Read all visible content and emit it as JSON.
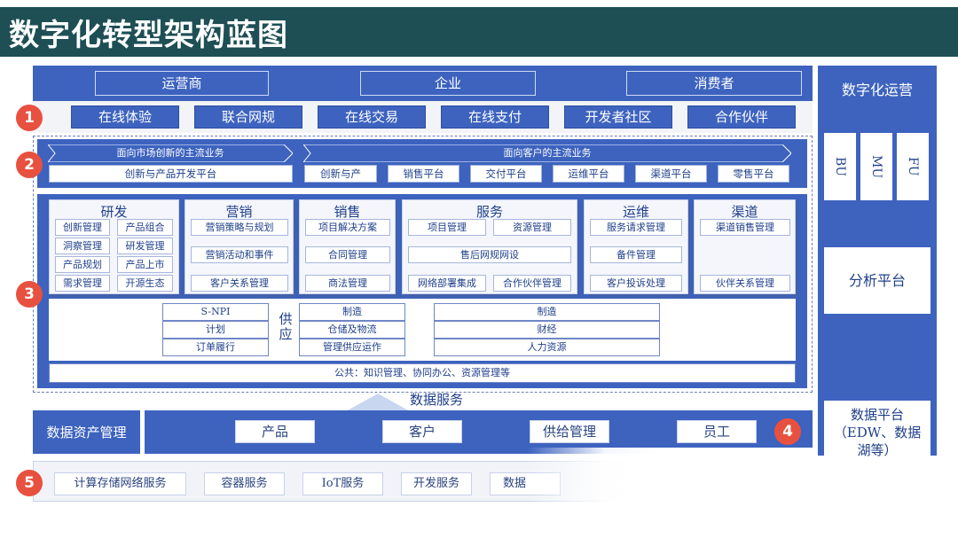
{
  "title": "数字化转型架构蓝图",
  "layer1": {
    "top_labels": [
      "运营商",
      "企业",
      "消费者"
    ],
    "channels": [
      "在线体验",
      "联合网规",
      "在线交易",
      "在线支付",
      "开发者社区",
      "合作伙伴"
    ]
  },
  "layer2": {
    "left_header": "面向市场创新的主流业务",
    "right_header": "面向客户的主流业务",
    "left_platform": "创新与产品开发平台",
    "right_platforms": [
      "创新与产",
      "销售平台",
      "交付平台",
      "运维平台",
      "渠道平台",
      "零售平台"
    ]
  },
  "layer3": {
    "cards": [
      {
        "title": "研发",
        "items": [
          "创新管理",
          "产品组合",
          "洞察管理",
          "研发管理",
          "产品规划",
          "产品上市",
          "需求管理",
          "开源生态"
        ]
      },
      {
        "title": "营销",
        "items": [
          "营销策略与规划",
          "营销活动和事件",
          "客户关系管理"
        ]
      },
      {
        "title": "销售",
        "items": [
          "项目解决方案",
          "合同管理",
          "商法管理"
        ]
      },
      {
        "title": "服务",
        "items": [
          "项目管理",
          "资源管理",
          "售后网规网设",
          "网络部署集成",
          "合作伙伴管理"
        ]
      },
      {
        "title": "运维",
        "items": [
          "服务请求管理",
          "备件管理",
          "客户投诉处理"
        ]
      },
      {
        "title": "渠道",
        "items": [
          "渠道销售管理",
          "伙伴关系管理"
        ]
      }
    ],
    "supply_label": "供应",
    "supply_left": [
      "S-NPI",
      "计划",
      "订单履行"
    ],
    "supply_mid": [
      "制造",
      "仓储及物流",
      "管理供应运作"
    ],
    "supply_right": [
      "制造",
      "财经",
      "人力资源"
    ],
    "public": "公共：知识管理、协同办公、资源管理等"
  },
  "layer4": {
    "data_service": "数据服务",
    "asset_mgmt": "数据资产管理",
    "items": [
      "产品",
      "客户",
      "供给管理",
      "员工"
    ]
  },
  "layer5": {
    "items": [
      "计算存储网络服务",
      "容器服务",
      "IoT服务",
      "开发服务",
      "数据"
    ]
  },
  "right": {
    "ops_title": "数字化运营",
    "units": [
      "BU",
      "MU",
      "FU"
    ],
    "analysis": "分析平台",
    "data_platform_1": "数据平台",
    "data_platform_2": "（EDW、数据",
    "data_platform_3": "湖等）"
  },
  "badges": [
    "1",
    "2",
    "3",
    "4",
    "5"
  ]
}
